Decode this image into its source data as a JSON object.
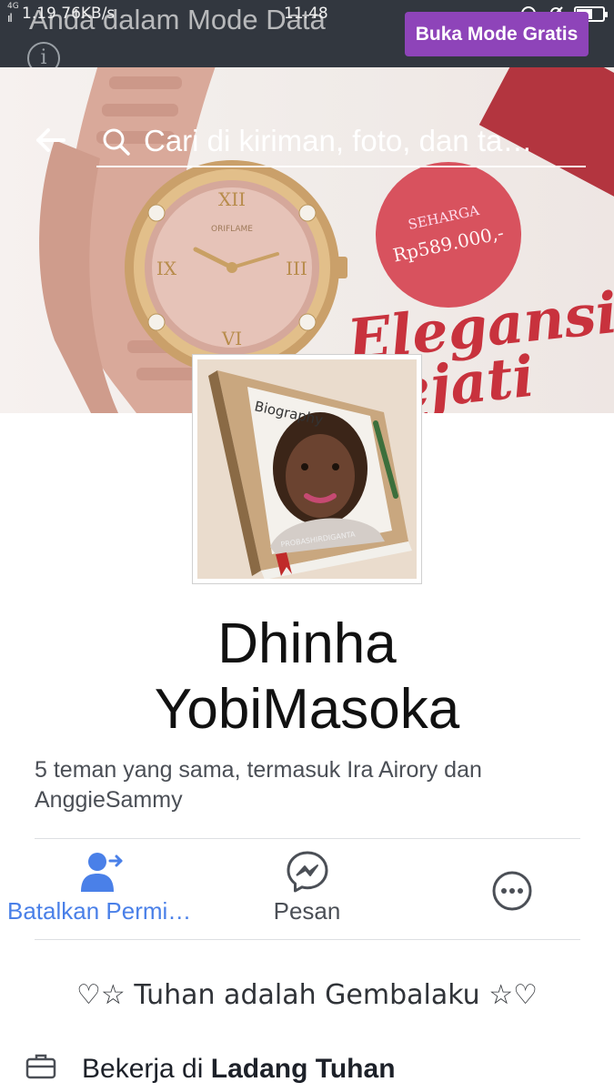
{
  "status_bar": {
    "network": "4G",
    "speed": "1.19 76KB/s",
    "time": "11.48",
    "battery_level": 0.6
  },
  "data_mode": {
    "message": "Anda dalam Mode Data",
    "info_icon": "info-icon",
    "free_mode_button": "Buka Mode Gratis"
  },
  "header": {
    "search_placeholder": "Cari di kiriman, foto, dan ta…"
  },
  "cover": {
    "price_caption": "SEHARGA",
    "price": "Rp589.000,-",
    "slogan": "Elegansi Sejati",
    "brand": "ORIFLAME"
  },
  "profile": {
    "name_line1": "Dhinha",
    "name_line2": "YobiMasoka",
    "mutual_friends": "5 teman yang sama, termasuk Ira Airory dan AnggieSammy",
    "book_title": "Biography",
    "book_author": "PROBASHIRDIGANTA"
  },
  "actions": [
    {
      "label": "Batalkan Permi…",
      "icon": "cancel-friend-request-icon",
      "color": "#4a80e8"
    },
    {
      "label": "Pesan",
      "icon": "messenger-icon",
      "color": "#4b4f56"
    },
    {
      "label": "",
      "icon": "more-icon",
      "color": "#4b4f56"
    }
  ],
  "about": {
    "motto": "♡☆ Tuhan adalah Gembalaku ☆♡",
    "work_prefix": "Bekerja di ",
    "work_place": "Ladang Tuhan"
  }
}
